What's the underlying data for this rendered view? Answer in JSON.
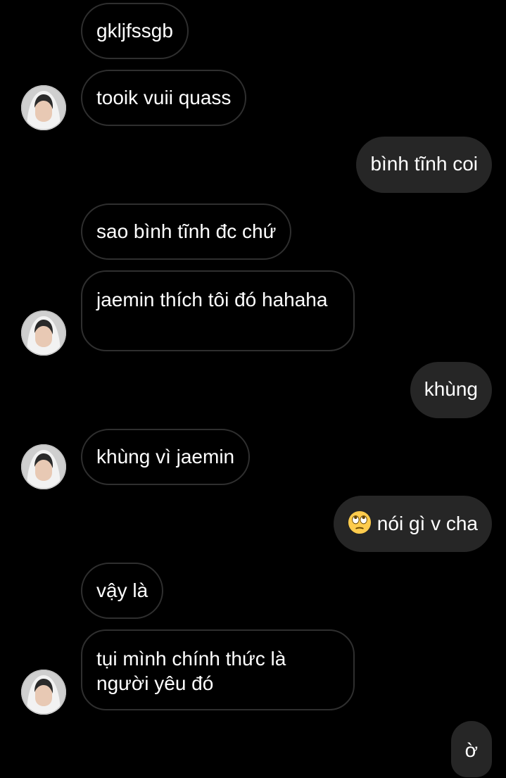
{
  "messages": [
    {
      "text": "gkljfssgb"
    },
    {
      "text": "tooik vuii quass"
    },
    {
      "text": "bình tĩnh coi"
    },
    {
      "text": "sao bình tĩnh đc chứ"
    },
    {
      "text": "jaemin thích tôi đó hahaha"
    },
    {
      "text": "khùng"
    },
    {
      "text": "khùng vì jaemin"
    },
    {
      "text": "nói gì v cha",
      "emoji": "face-with-rolling-eyes-icon"
    },
    {
      "text": "vậy là"
    },
    {
      "text": "tụi mình chính thức là người yêu đó"
    },
    {
      "text": "ờ"
    }
  ],
  "colors": {
    "background": "#000000",
    "incoming_border": "#2f2f2f",
    "outgoing_bubble": "#262626",
    "text": "#ffffff"
  }
}
